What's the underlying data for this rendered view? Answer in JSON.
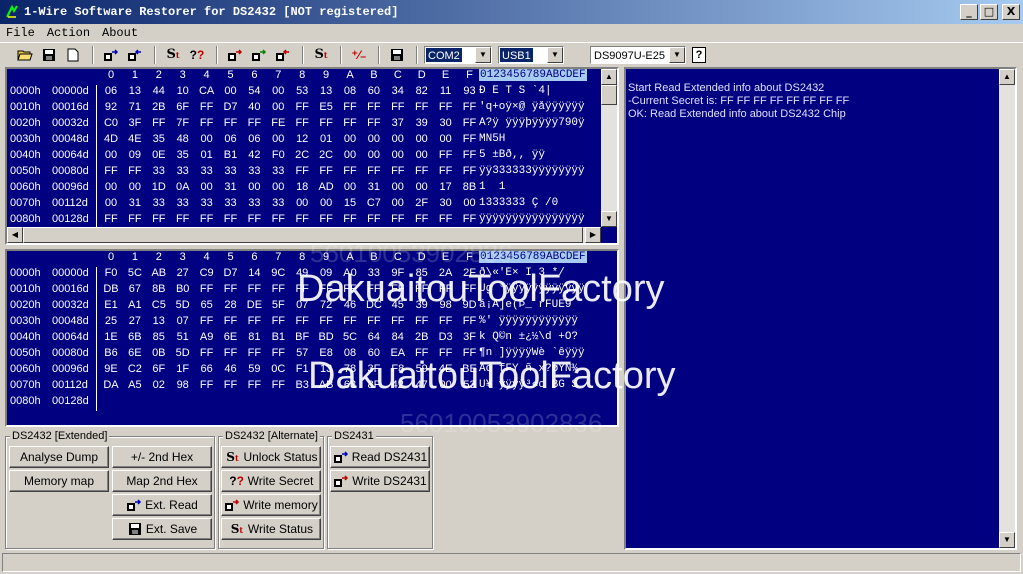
{
  "window": {
    "title": "1-Wire Software Restorer for DS2432 [NOT registered]",
    "controls": [
      "_",
      "□",
      "X"
    ]
  },
  "menu": [
    "File",
    "Action",
    "About"
  ],
  "toolbar": {
    "port": "COM2",
    "adapter": "USB1",
    "device": "DS9097U-E25",
    "help": "?"
  },
  "hex_header": {
    "columns": [
      "0",
      "1",
      "2",
      "3",
      "4",
      "5",
      "6",
      "7",
      "8",
      "9",
      "A",
      "B",
      "C",
      "D",
      "E",
      "F"
    ],
    "ascii": "0123456789ABCDEF"
  },
  "hex_top": {
    "rows": [
      {
        "addr": "0000h",
        "dec": "00000d",
        "bytes": [
          "06",
          "13",
          "44",
          "10",
          "CA",
          "00",
          "54",
          "00",
          "53",
          "13",
          "08",
          "60",
          "34",
          "82",
          "11",
          "93"
        ],
        "ascii": "  Ð Ê T S  `4| "
      },
      {
        "addr": "0010h",
        "dec": "00016d",
        "bytes": [
          "92",
          "71",
          "2B",
          "6F",
          "FF",
          "D7",
          "40",
          "00",
          "FF",
          "E5",
          "FF",
          "FF",
          "FF",
          "FF",
          "FF",
          "FF"
        ],
        "ascii": "'q+oÿ×@ ÿåÿÿÿÿÿÿ"
      },
      {
        "addr": "0020h",
        "dec": "00032d",
        "bytes": [
          "C0",
          "3F",
          "FF",
          "7F",
          "FF",
          "FF",
          "FF",
          "FE",
          "FF",
          "FF",
          "FF",
          "FF",
          "37",
          "39",
          "30",
          "FF"
        ],
        "ascii": "À?ÿ ÿÿÿþÿÿÿÿ790ÿ"
      },
      {
        "addr": "0030h",
        "dec": "00048d",
        "bytes": [
          "4D",
          "4E",
          "35",
          "48",
          "00",
          "06",
          "06",
          "00",
          "12",
          "01",
          "00",
          "00",
          "00",
          "00",
          "00",
          "FF"
        ],
        "ascii": "MN5H           "
      },
      {
        "addr": "0040h",
        "dec": "00064d",
        "bytes": [
          "00",
          "09",
          "0E",
          "35",
          "01",
          "B1",
          "42",
          "F0",
          "2C",
          "2C",
          "00",
          "00",
          "00",
          "00",
          "FF",
          "FF"
        ],
        "ascii": "   5 ±Bð,,    ÿÿ"
      },
      {
        "addr": "0050h",
        "dec": "00080d",
        "bytes": [
          "FF",
          "FF",
          "33",
          "33",
          "33",
          "33",
          "33",
          "33",
          "FF",
          "FF",
          "FF",
          "FF",
          "FF",
          "FF",
          "FF",
          "FF"
        ],
        "ascii": "ÿÿ333333ÿÿÿÿÿÿÿÿ"
      },
      {
        "addr": "0060h",
        "dec": "00096d",
        "bytes": [
          "00",
          "00",
          "1D",
          "0A",
          "00",
          "31",
          "00",
          "00",
          "18",
          "AD",
          "00",
          "31",
          "00",
          "00",
          "17",
          "8B"
        ],
        "ascii": "     1   ­ 1    "
      },
      {
        "addr": "0070h",
        "dec": "00112d",
        "bytes": [
          "00",
          "31",
          "33",
          "33",
          "33",
          "33",
          "33",
          "33",
          "00",
          "00",
          "15",
          "C7",
          "00",
          "2F",
          "30",
          "00"
        ],
        "ascii": " 1333333   Ç /0 "
      },
      {
        "addr": "0080h",
        "dec": "00128d",
        "bytes": [
          "FF",
          "FF",
          "FF",
          "FF",
          "FF",
          "FF",
          "FF",
          "FF",
          "FF",
          "FF",
          "FF",
          "FF",
          "FF",
          "FF",
          "FF",
          "FF"
        ],
        "ascii": "ÿÿÿÿÿÿÿÿÿÿÿÿÿÿÿÿ"
      }
    ]
  },
  "hex_bottom": {
    "rows": [
      {
        "addr": "0000h",
        "dec": "00000d",
        "bytes": [
          "F0",
          "5C",
          "AB",
          "27",
          "C9",
          "D7",
          "14",
          "9C",
          "49",
          "09",
          "A0",
          "33",
          "9F",
          "85",
          "2A",
          "2F"
        ],
        "ascii": "ð\\«'É×  I  3  */"
      },
      {
        "addr": "0010h",
        "dec": "00016d",
        "bytes": [
          "DB",
          "67",
          "8B",
          "B0",
          "FF",
          "FF",
          "FF",
          "FF",
          "FF",
          "FF",
          "FF",
          "FF",
          "FF",
          "FF",
          "FF",
          "FF"
        ],
        "ascii": "Ûg °ÿÿÿÿÿÿÿÿÿÿÿÿ"
      },
      {
        "addr": "0020h",
        "dec": "00032d",
        "bytes": [
          "E1",
          "A1",
          "C5",
          "5D",
          "65",
          "28",
          "DE",
          "5F",
          "07",
          "72",
          "46",
          "DC",
          "45",
          "39",
          "98",
          "9D"
        ],
        "ascii": "á¡Å]e(Þ_ rFÜE9  "
      },
      {
        "addr": "0030h",
        "dec": "00048d",
        "bytes": [
          "25",
          "27",
          "13",
          "07",
          "FF",
          "FF",
          "FF",
          "FF",
          "FF",
          "FF",
          "FF",
          "FF",
          "FF",
          "FF",
          "FF",
          "FF"
        ],
        "ascii": "%'  ÿÿÿÿÿÿÿÿÿÿÿÿ"
      },
      {
        "addr": "0040h",
        "dec": "00064d",
        "bytes": [
          "1E",
          "6B",
          "85",
          "51",
          "A9",
          "6E",
          "81",
          "B1",
          "BF",
          "BD",
          "5C",
          "64",
          "84",
          "2B",
          "D3",
          "3F"
        ],
        "ascii": " k Q©n ±¿½\\d +Ó?"
      },
      {
        "addr": "0050h",
        "dec": "00080d",
        "bytes": [
          "B6",
          "6E",
          "0B",
          "5D",
          "FF",
          "FF",
          "FF",
          "FF",
          "57",
          "E8",
          "08",
          "60",
          "EA",
          "FF",
          "FF",
          "FF"
        ],
        "ascii": "¶n ]ÿÿÿÿWè `êÿÿÿ"
      },
      {
        "addr": "0060h",
        "dec": "00096d",
        "bytes": [
          "9E",
          "C2",
          "6F",
          "1F",
          "66",
          "46",
          "59",
          "0C",
          "F1",
          "13",
          "78",
          "3F",
          "F8",
          "59",
          "4E",
          "BE"
        ],
        "ascii": " Âo fFY ñ x?øYN¾"
      },
      {
        "addr": "0070h",
        "dec": "00112d",
        "bytes": [
          "DA",
          "A5",
          "02",
          "98",
          "FF",
          "FF",
          "FF",
          "FF",
          "B3",
          "AB",
          "63",
          "8F",
          "42",
          "47",
          "00",
          "53"
        ],
        "ascii": "Ú¥  ÿÿÿÿ³«c BG S"
      },
      {
        "addr": "0080h",
        "dec": "00128d",
        "bytes": [],
        "ascii": ""
      }
    ]
  },
  "log": [
    "Start Read Extended info about DS2432",
    "-Current Secret is: FF FF FF FF FF FF FF FF",
    "OK: Read Extended info about DS2432 Chip"
  ],
  "groups": {
    "extended": {
      "title": "DS2432 [Extended]",
      "analyse_dump": "Analyse Dump",
      "memory_map": "Memory map",
      "toggle_2nd_hex": "+/- 2nd Hex",
      "map_2nd_hex": "Map 2nd Hex",
      "ext_read": "Ext. Read",
      "ext_save": "Ext. Save"
    },
    "alternate": {
      "title": "DS2432 [Alternate]",
      "unlock_status": "Unlock Status",
      "write_secret": "Write Secret",
      "write_memory": "Write memory",
      "write_status": "Write Status"
    },
    "ds2431": {
      "title": "DS2431",
      "read": "Read DS2431",
      "write": "Write DS2431"
    }
  },
  "watermark": "DakuaitouToolFactory",
  "faint_watermark": "56010053902836"
}
